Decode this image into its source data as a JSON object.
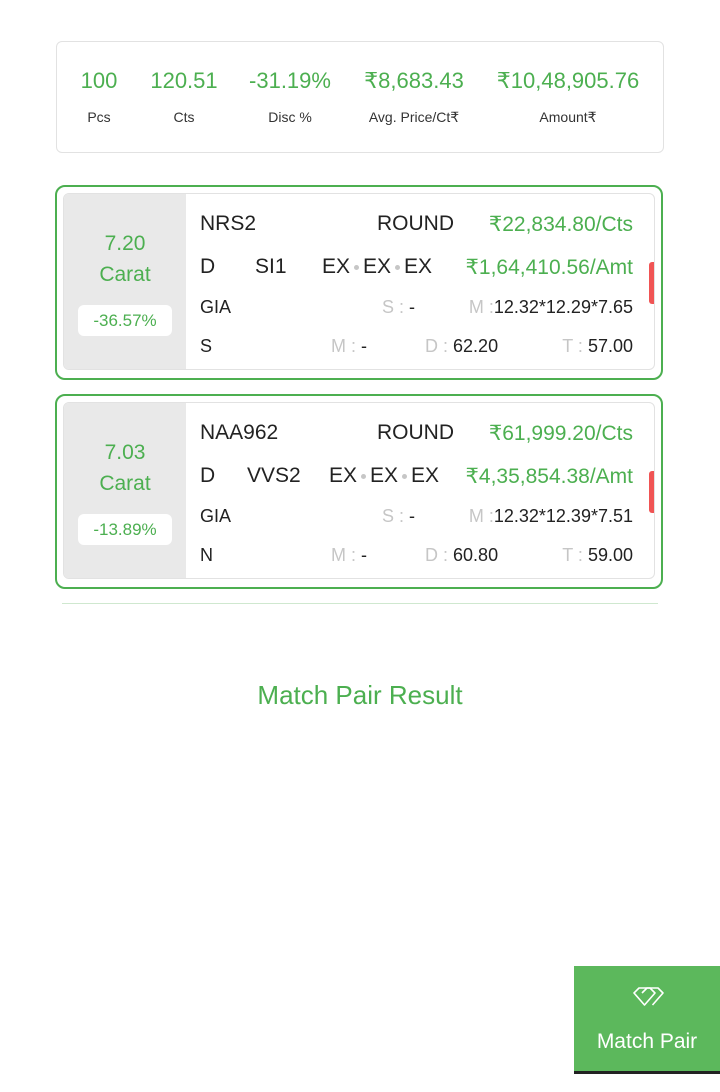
{
  "summary": {
    "pcs": {
      "value": "100",
      "label": "Pcs"
    },
    "cts": {
      "value": "120.51",
      "label": "Cts"
    },
    "disc": {
      "value": "-31.19%",
      "label": "Disc %"
    },
    "avg_price": {
      "value": "₹8,683.43",
      "label": "Avg. Price/Ct₹"
    },
    "amount": {
      "value": "₹10,48,905.76",
      "label": "Amount₹"
    }
  },
  "stones": [
    {
      "carat": "7.20",
      "carat_unit": "Carat",
      "discount": "-36.57%",
      "stone_id": "NRS2",
      "shape": "ROUND",
      "price_per_ct": "₹22,834.80/Cts",
      "color": "D",
      "clarity": "SI1",
      "cut": "EX",
      "polish": "EX",
      "symmetry": "EX",
      "amount": "₹1,64,410.56/Amt",
      "lab": "GIA",
      "s_label": "S :",
      "s_value": "-",
      "m_label": "M :",
      "measurements": "12.32*12.29*7.65",
      "fluorescence": "S",
      "m2_label": "M :",
      "m2_value": "-",
      "d_label": "D :",
      "depth": "62.20",
      "t_label": "T :",
      "table": "57.00"
    },
    {
      "carat": "7.03",
      "carat_unit": "Carat",
      "discount": "-13.89%",
      "stone_id": "NAA962",
      "shape": "ROUND",
      "price_per_ct": "₹61,999.20/Cts",
      "color": "D",
      "clarity": "VVS2",
      "cut": "EX",
      "polish": "EX",
      "symmetry": "EX",
      "amount": "₹4,35,854.38/Amt",
      "lab": "GIA",
      "s_label": "S :",
      "s_value": "-",
      "m_label": "M :",
      "measurements": "12.32*12.39*7.51",
      "fluorescence": "N",
      "m2_label": "M :",
      "m2_value": "-",
      "d_label": "D :",
      "depth": "60.80",
      "t_label": "T :",
      "table": "59.00"
    }
  ],
  "match_result_title": "Match Pair Result",
  "match_button": {
    "label": "Match Pair",
    "icon": "diamond-pair-icon"
  },
  "colors": {
    "accent": "#4caf50",
    "alert": "#f05454"
  }
}
